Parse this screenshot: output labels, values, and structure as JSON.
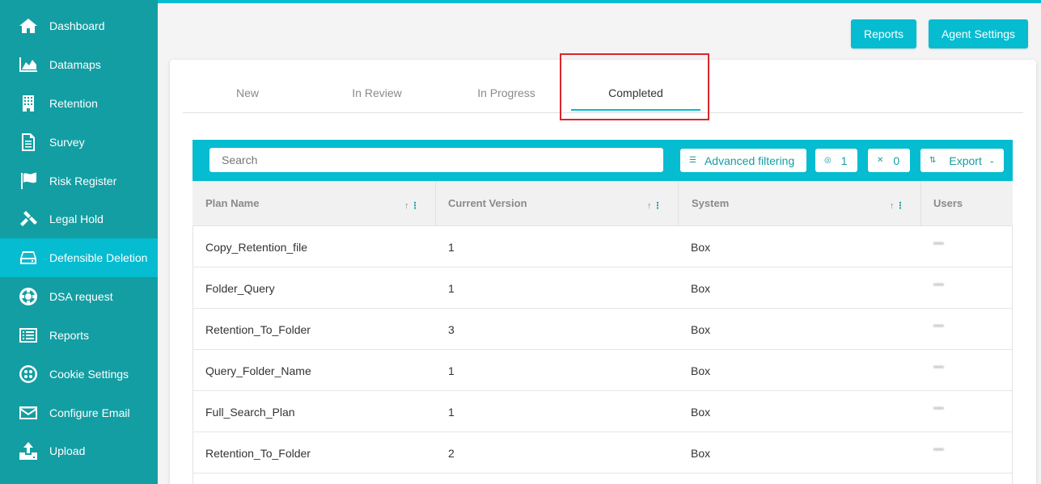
{
  "sidebar": {
    "items": [
      {
        "label": "Dashboard",
        "icon": "home-icon"
      },
      {
        "label": "Datamaps",
        "icon": "area-chart-icon"
      },
      {
        "label": "Retention",
        "icon": "building-icon"
      },
      {
        "label": "Survey",
        "icon": "document-icon"
      },
      {
        "label": "Risk Register",
        "icon": "flag-icon"
      },
      {
        "label": "Legal Hold",
        "icon": "gavel-icon"
      },
      {
        "label": "Defensible Deletion",
        "icon": "hard-drive-icon",
        "active": true
      },
      {
        "label": "DSA request",
        "icon": "lifebuoy-icon"
      },
      {
        "label": "Reports",
        "icon": "list-icon"
      },
      {
        "label": "Cookie Settings",
        "icon": "cookie-icon"
      },
      {
        "label": "Configure Email",
        "icon": "envelope-icon"
      },
      {
        "label": "Upload",
        "icon": "upload-icon"
      }
    ]
  },
  "header": {
    "reports_label": "Reports",
    "agent_settings_label": "Agent Settings"
  },
  "tabs": [
    {
      "label": "New"
    },
    {
      "label": "In Review"
    },
    {
      "label": "In Progress"
    },
    {
      "label": "Completed",
      "active": true
    }
  ],
  "toolbar": {
    "search_placeholder": "Search",
    "advanced_filtering_label": "Advanced filtering",
    "hidden_count": "1",
    "pinned_count": "0",
    "export_label": "Export"
  },
  "table": {
    "columns": [
      "Plan Name",
      "Current Version",
      "System",
      "Users"
    ],
    "rows": [
      [
        "Copy_Retention_file",
        "1",
        "Box"
      ],
      [
        "Folder_Query",
        "1",
        "Box"
      ],
      [
        "Retention_To_Folder",
        "3",
        "Box"
      ],
      [
        "Query_Folder_Name",
        "1",
        "Box"
      ],
      [
        "Full_Search_Plan",
        "1",
        "Box"
      ],
      [
        "Retention_To_Folder",
        "2",
        "Box"
      ]
    ]
  },
  "colors": {
    "sidebar": "#139ea3",
    "accent": "#05bcd0",
    "highlight": "#d9262e"
  }
}
